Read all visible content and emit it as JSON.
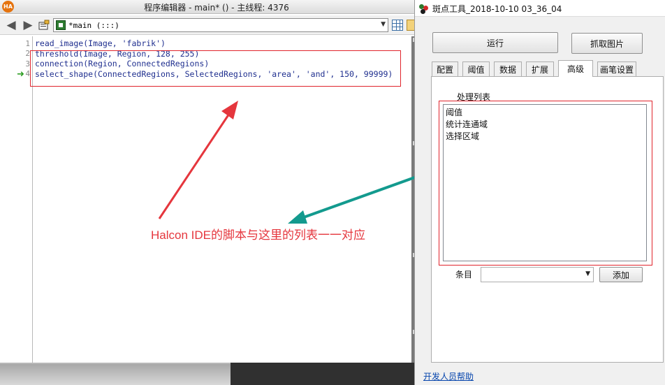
{
  "editor": {
    "logo_text": "HA",
    "title": "程序编辑器 - main* () - 主线程: 4376",
    "procedure_select": "*main (:::)",
    "lines": [
      {
        "no": "1",
        "code": "read_image(Image, 'fabrik')"
      },
      {
        "no": "2",
        "code": "threshold(Image, Region, 128, 255)"
      },
      {
        "no": "3",
        "code": "connection(Region, ConnectedRegions)"
      },
      {
        "no": "4",
        "code": "select_shape(ConnectedRegions, SelectedRegions, 'area', 'and', 150, 99999)"
      }
    ],
    "icons": [
      "arrow-left-icon",
      "arrow-right-icon",
      "open-procedure-icon",
      "procedure-icon",
      "grid-icon",
      "save-icon",
      "program-counter-arrow-icon"
    ]
  },
  "annotation": {
    "text": "Halcon IDE的脚本与这里的列表一一对应",
    "color": "#e5363d",
    "arrow_colors": [
      "#e5363d",
      "#139a8e"
    ]
  },
  "tool": {
    "title": "斑点工具_2018-10-10 03_36_04",
    "run_label": "运行",
    "capture_label": "抓取图片",
    "tabs": [
      "配置",
      "阈值",
      "数据",
      "扩展",
      "高级",
      "画笔设置"
    ],
    "active_tab": "高级",
    "process_list_label": "处理列表",
    "process_list": [
      "阈值",
      "统计连通域",
      "选择区域"
    ],
    "entry_label": "条目",
    "entry_value": "",
    "add_label": "添加",
    "dev_help_link": "开发人员帮助"
  },
  "colors": {
    "highlight_box": "#e0242c",
    "code_text": "#1f2f8f",
    "link": "#0645ad"
  }
}
